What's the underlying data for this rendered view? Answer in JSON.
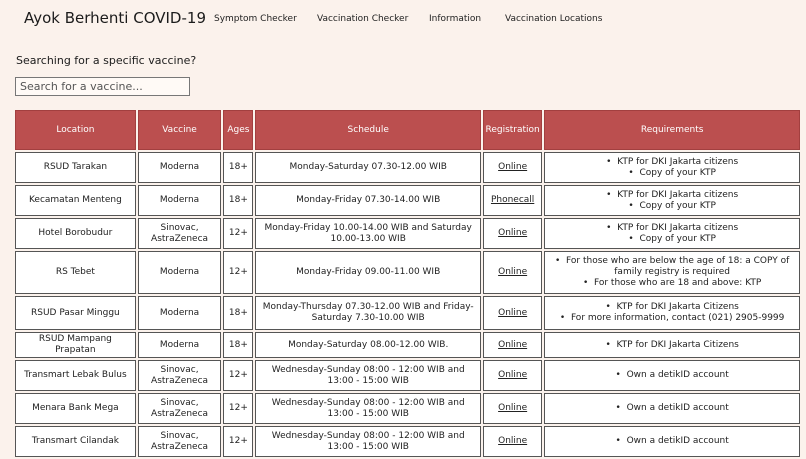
{
  "nav": {
    "brand": "Ayok Berhenti COVID-19",
    "links": [
      "Symptom Checker",
      "Vaccination Checker",
      "Information",
      "Vaccination Locations"
    ]
  },
  "search": {
    "label": "Searching for a specific vaccine?",
    "placeholder": "Search for a vaccine..."
  },
  "table": {
    "headers": [
      "Location",
      "Vaccine",
      "Ages",
      "Schedule",
      "Registration",
      "Requirements"
    ],
    "rows": [
      {
        "location": "RSUD Tarakan",
        "vaccine": "Moderna",
        "ages": "18+",
        "schedule": "Monday-Saturday 07.30-12.00 WIB",
        "registration": "Online",
        "requirements": [
          "KTP for DKI Jakarta citizens",
          "Copy of your KTP"
        ]
      },
      {
        "location": "Kecamatan Menteng",
        "vaccine": "Moderna",
        "ages": "18+",
        "schedule": "Monday-Friday 07.30-14.00 WIB",
        "registration": "Phonecall",
        "requirements": [
          "KTP for DKI Jakarta citizens",
          "Copy of your KTP"
        ]
      },
      {
        "location": "Hotel Borobudur",
        "vaccine": "Sinovac, AstraZeneca",
        "ages": "12+",
        "schedule": "Monday-Friday 10.00-14.00 WIB and Saturday 10.00-13.00 WIB",
        "registration": "Online",
        "requirements": [
          "KTP for DKI Jakarta citizens",
          "Copy of your KTP"
        ]
      },
      {
        "location": "RS Tebet",
        "vaccine": "Moderna",
        "ages": "12+",
        "schedule": "Monday-Friday 09.00-11.00 WIB",
        "registration": "Online",
        "requirements": [
          "For those who are below the age of 18: a COPY of family registry is required",
          "For those who are 18 and above: KTP"
        ]
      },
      {
        "location": "RSUD Pasar Minggu",
        "vaccine": "Moderna",
        "ages": "18+",
        "schedule": "Monday-Thursday 07.30-12.00 WIB and Friday-Saturday 7.30-10.00 WIB",
        "registration": "Online",
        "requirements": [
          "KTP for DKI Jakarta Citizens",
          "For more information, contact (021) 2905-9999"
        ]
      },
      {
        "location": "RSUD Mampang Prapatan",
        "vaccine": "Moderna",
        "ages": "18+",
        "schedule": "Monday-Saturday 08.00-12.00 WIB.",
        "registration": "Online",
        "requirements": [
          "KTP for DKI Jakarta Citizens"
        ]
      },
      {
        "location": "Transmart Lebak Bulus",
        "vaccine": "Sinovac, AstraZeneca",
        "ages": "12+",
        "schedule": "Wednesday-Sunday 08:00 - 12:00 WIB and 13:00 - 15:00 WIB",
        "registration": "Online",
        "requirements": [
          "Own a detikID account"
        ]
      },
      {
        "location": "Menara Bank Mega",
        "vaccine": "Sinovac, AstraZeneca",
        "ages": "12+",
        "schedule": "Wednesday-Sunday 08:00 - 12:00 WIB and 13:00 - 15:00 WIB",
        "registration": "Online",
        "requirements": [
          "Own a detikID account"
        ]
      },
      {
        "location": "Transmart Cilandak",
        "vaccine": "Sinovac, AstraZeneca",
        "ages": "12+",
        "schedule": "Wednesday-Sunday 08:00 - 12:00 WIB and 13:00 - 15:00 WIB",
        "registration": "Online",
        "requirements": [
          "Own a detikID account"
        ]
      }
    ]
  }
}
